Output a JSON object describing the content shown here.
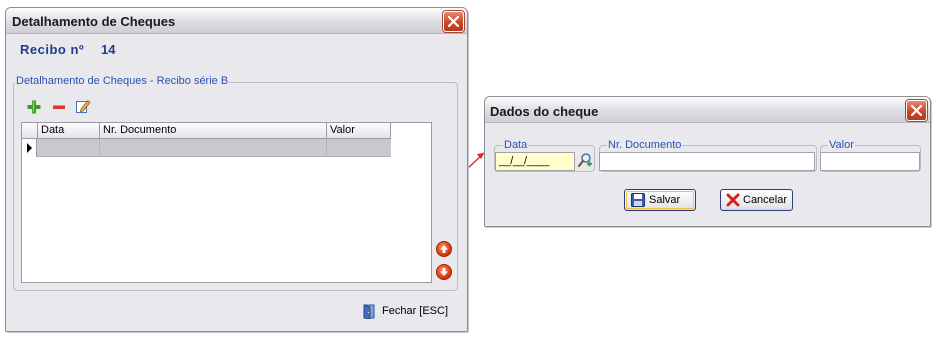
{
  "main_window": {
    "title": "Detalhamento de Cheques",
    "recibo_label": "Recibo nº",
    "recibo_number": "14",
    "group_title": "Detalhamento de Cheques - Recibo série B",
    "toolbar": {
      "add_icon": "plus-icon",
      "remove_icon": "minus-icon",
      "edit_icon": "edit-icon"
    },
    "grid": {
      "columns": [
        "Data",
        "Nr. Documento",
        "Valor"
      ],
      "rows": [
        [
          "",
          "",
          ""
        ]
      ]
    },
    "move_up_icon": "arrow-up-icon",
    "move_down_icon": "arrow-down-icon",
    "close_label": "Fechar [ESC]"
  },
  "dialog": {
    "title": "Dados do cheque",
    "data_label": "Data",
    "data_value": "__/__/____",
    "nr_documento_label": "Nr. Documento",
    "nr_documento_value": "",
    "valor_label": "Valor",
    "valor_value": "",
    "save_label": "Salvar",
    "cancel_label": "Cancelar"
  },
  "colors": {
    "accent_blue": "#1c3e8c",
    "group_label_blue": "#2d50b5",
    "close_red": "#c9462a",
    "connector_red": "#e0201e",
    "date_field_yellow": "#ffffcc"
  }
}
